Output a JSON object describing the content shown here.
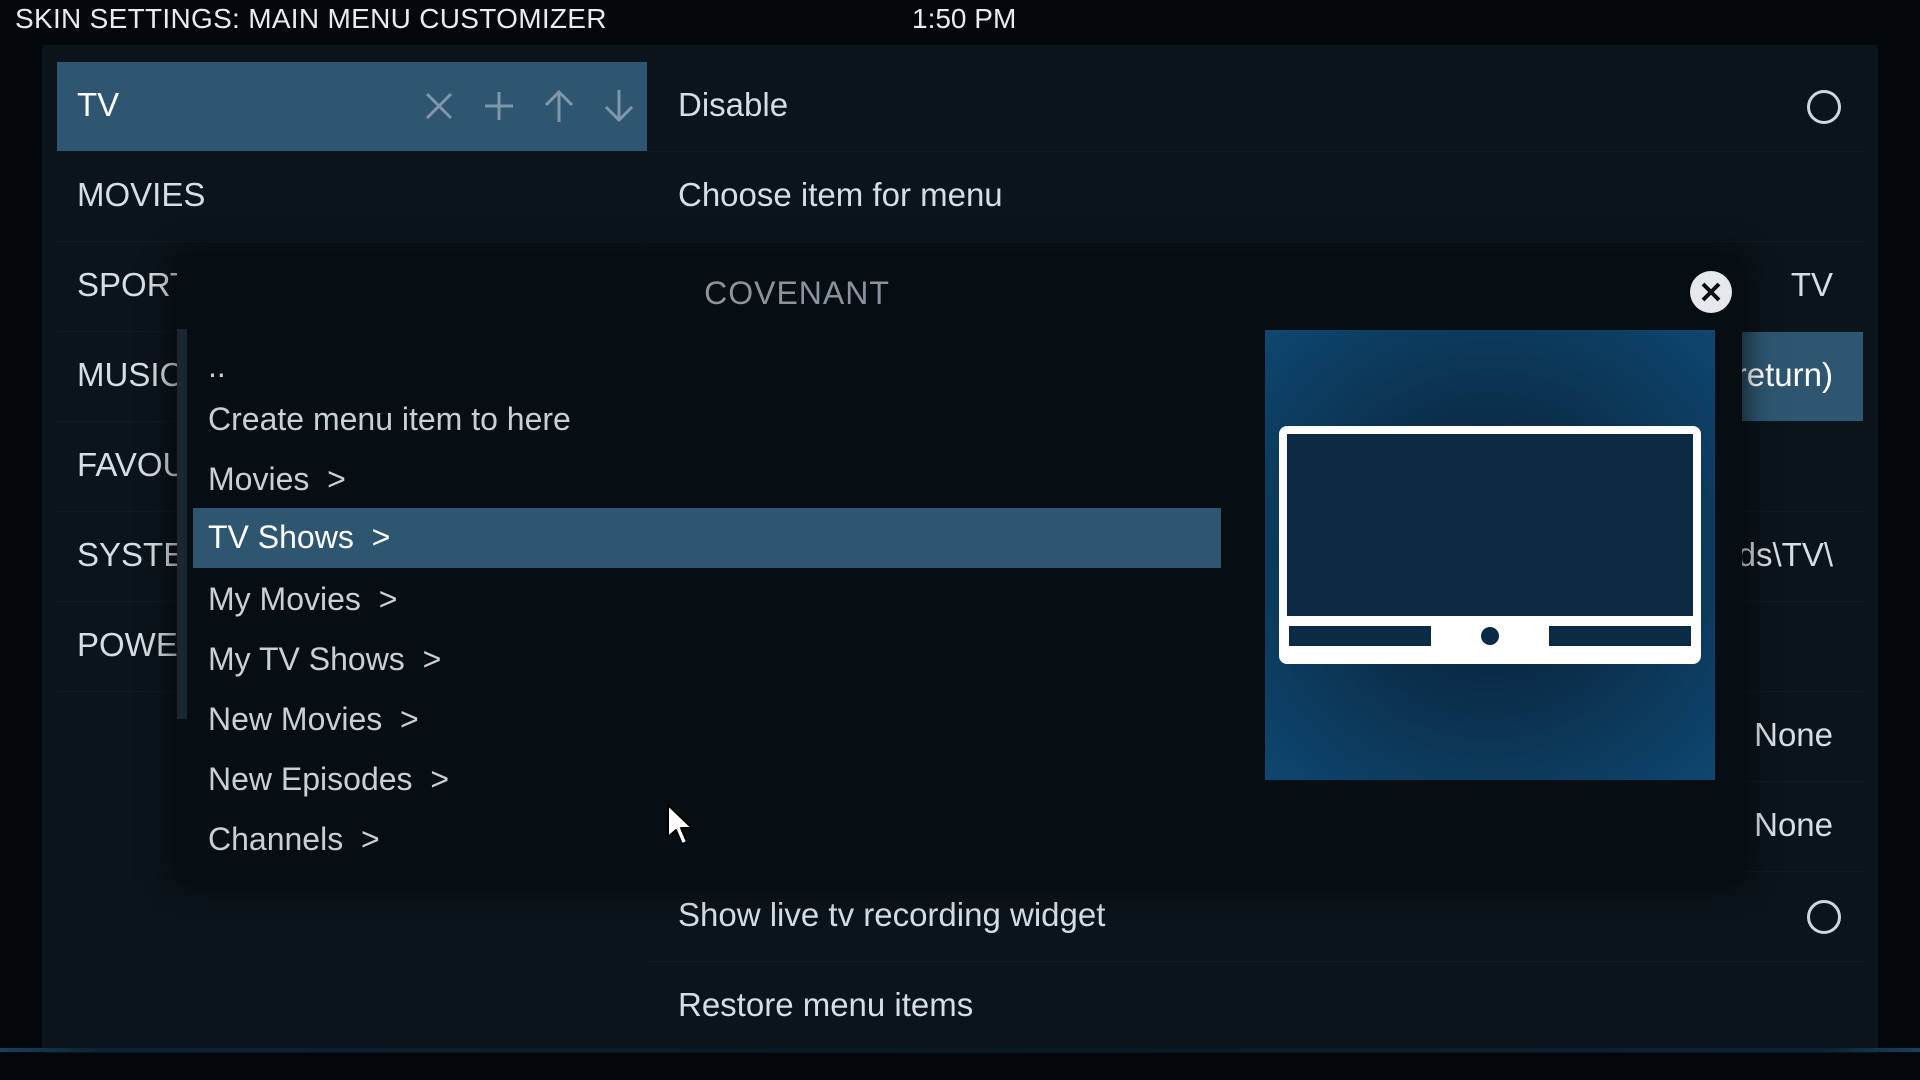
{
  "header": {
    "title": "SKIN SETTINGS: MAIN MENU CUSTOMIZER",
    "time": "1:50 PM"
  },
  "menu": {
    "items": [
      {
        "label": "TV"
      },
      {
        "label": "MOVIES"
      },
      {
        "label": "SPORTS"
      },
      {
        "label": "MUSIC"
      },
      {
        "label": "FAVOU"
      },
      {
        "label": "SYSTEM"
      },
      {
        "label": "POWER"
      }
    ],
    "selected_actions": [
      "close-icon",
      "plus-icon",
      "arrow-up-icon",
      "arrow-down-icon"
    ]
  },
  "settings": {
    "rows": [
      {
        "label": "Disable",
        "type": "radio"
      },
      {
        "label": "Choose item for menu"
      },
      {
        "label": "",
        "value": "TV"
      },
      {
        "label": "",
        "value": "return)"
      },
      {
        "label": ""
      },
      {
        "label": "",
        "value": "ds\\TV\\"
      },
      {
        "label": ""
      },
      {
        "label": "",
        "value": "None"
      },
      {
        "label": "",
        "value": "None"
      },
      {
        "label": "Show live tv recording widget",
        "type": "radio"
      },
      {
        "label": "Restore menu items"
      }
    ]
  },
  "popup": {
    "title": "COVENANT",
    "items": [
      {
        "label": ".."
      },
      {
        "label": "Create menu item to here"
      },
      {
        "label": "Movies  >"
      },
      {
        "label": "TV Shows  >"
      },
      {
        "label": "My Movies  >"
      },
      {
        "label": "My TV Shows  >"
      },
      {
        "label": "New Movies  >"
      },
      {
        "label": "New Episodes  >"
      },
      {
        "label": "Channels  >"
      }
    ],
    "selected_index": 3,
    "thumbnail_icon": "tv-icon"
  },
  "colors": {
    "accent": "#2e5670",
    "background": "#0b141b",
    "thumb": "#0c3a5d"
  }
}
